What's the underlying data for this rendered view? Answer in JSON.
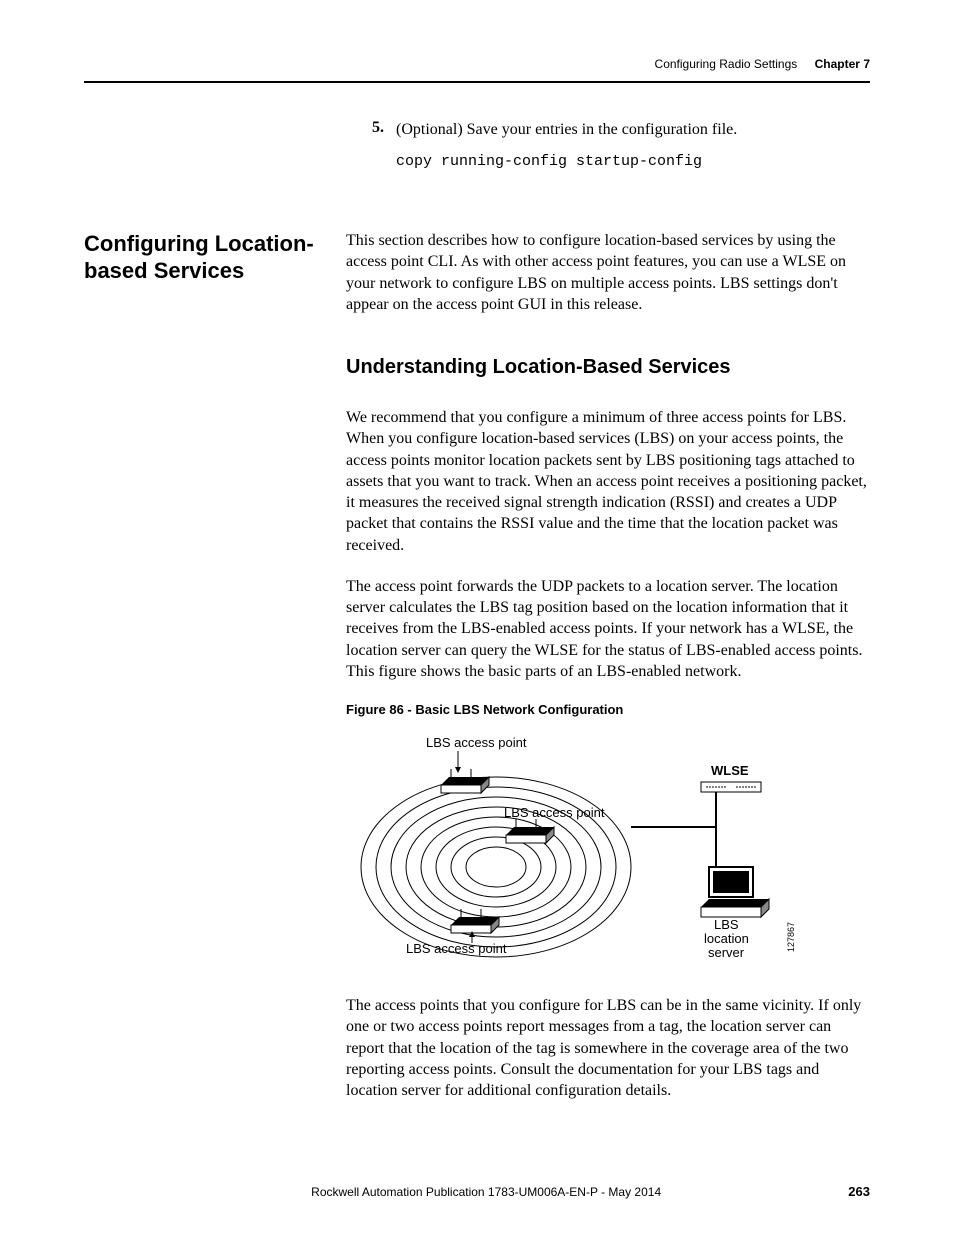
{
  "header": {
    "section_title": "Configuring Radio Settings",
    "chapter_label": "Chapter 7"
  },
  "step": {
    "number": "5.",
    "text": "(Optional) Save your entries in the configuration file.",
    "code": "copy running-config startup-config"
  },
  "section": {
    "heading": "Configuring Location-based Services",
    "intro": "This section describes how to configure location-based services by using the access point CLI. As with other access point features, you can use a WLSE on your network to configure LBS on multiple access points. LBS settings don't appear on the access point GUI in this release."
  },
  "subsection": {
    "heading": "Understanding Location-Based Services",
    "para1": "We recommend that you configure a minimum of three access points for LBS. When you configure location-based services (LBS) on your access points, the access points monitor location packets sent by LBS positioning tags attached to assets that you want to track. When an access point receives a positioning packet, it measures the received signal strength indication (RSSI) and creates a UDP packet that contains the RSSI value and the time that the location packet was received.",
    "para2": "The access point forwards the UDP packets to a location server. The location server calculates the LBS tag position based on the location information that it receives from the LBS-enabled access points. If your network has a WLSE, the location server can query the WLSE for the status of LBS-enabled access points. This figure shows the basic parts of an LBS-enabled network.",
    "para3": "The access points that you configure for LBS can be in the same vicinity. If only one or two access points report messages from a tag, the location server can report that the location of the tag is somewhere in the coverage area of the two reporting access points. Consult the documentation for your LBS tags and location server for additional configuration details."
  },
  "figure": {
    "caption": "Figure 86 - Basic LBS Network Configuration",
    "labels": {
      "ap_top": "LBS access point",
      "ap_mid": "LBS access point",
      "ap_bot": "LBS access point",
      "wlse": "WLSE",
      "server_line1": "LBS",
      "server_line2": "location",
      "server_line3": "server",
      "id": "127867"
    }
  },
  "footer": {
    "publication": "Rockwell Automation Publication 1783-UM006A-EN-P - May 2014",
    "page": "263"
  }
}
